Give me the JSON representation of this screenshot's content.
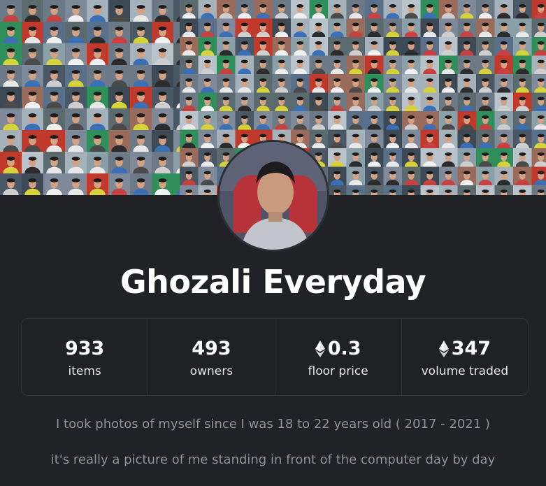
{
  "collection": {
    "name": "Ghozali Everyday"
  },
  "stats": [
    {
      "value": "933",
      "label": "items",
      "eth": false
    },
    {
      "value": "493",
      "label": "owners",
      "eth": false
    },
    {
      "value": "0.3",
      "label": "floor price",
      "eth": true
    },
    {
      "value": "347",
      "label": "volume traded",
      "eth": true
    }
  ],
  "description": {
    "line1": "I took photos of myself since I was 18 to 22 years old ( 2017 - 2021 )",
    "line2": "it's really a picture of me standing in front of the computer day by day"
  },
  "colors": {
    "background": "#202225",
    "border": "#303338",
    "text_primary": "#ffffff",
    "text_muted": "#8a939b"
  },
  "icons": {
    "currency": "ethereum-icon"
  }
}
